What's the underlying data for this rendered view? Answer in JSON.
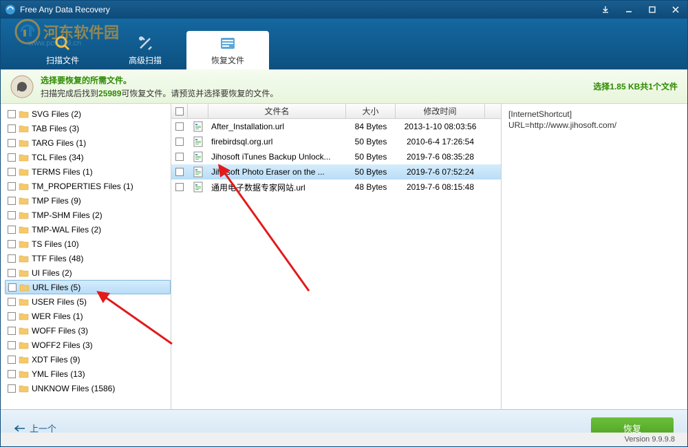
{
  "window": {
    "title": "Free Any Data Recovery"
  },
  "watermark": {
    "text": "河东软件园",
    "sub": "www.pc0359.cn"
  },
  "tabs": [
    {
      "label": "扫描文件",
      "active": false
    },
    {
      "label": "高级扫描",
      "active": false
    },
    {
      "label": "恢复文件",
      "active": true
    }
  ],
  "info": {
    "title": "选择要恢复的所需文件。",
    "sub_prefix": "扫描完成后找到",
    "count": "25989",
    "sub_suffix": "可恢复文件。请预览并选择要恢复的文件。",
    "right": "选择1.85 KB共1个文件"
  },
  "sidebar_items": [
    {
      "label": "SVG Files (2)"
    },
    {
      "label": "TAB Files (3)"
    },
    {
      "label": "TARG Files (1)"
    },
    {
      "label": "TCL Files (34)"
    },
    {
      "label": "TERMS Files (1)"
    },
    {
      "label": "TM_PROPERTIES Files (1)"
    },
    {
      "label": "TMP Files (9)"
    },
    {
      "label": "TMP-SHM Files (2)"
    },
    {
      "label": "TMP-WAL Files (2)"
    },
    {
      "label": "TS Files (10)"
    },
    {
      "label": "TTF Files (48)"
    },
    {
      "label": "UI Files (2)"
    },
    {
      "label": "URL Files (5)",
      "selected": true
    },
    {
      "label": "USER Files (5)"
    },
    {
      "label": "WER Files (1)"
    },
    {
      "label": "WOFF Files (3)"
    },
    {
      "label": "WOFF2 Files (3)"
    },
    {
      "label": "XDT Files (9)"
    },
    {
      "label": "YML Files (13)"
    },
    {
      "label": "UNKNOW Files (1586)"
    }
  ],
  "columns": {
    "name": "文件名",
    "size": "大小",
    "date": "修改时间"
  },
  "rows": [
    {
      "name": "After_Installation.url",
      "size": "84 Bytes",
      "date": "2013-1-10 08:03:56"
    },
    {
      "name": "firebirdsql.org.url",
      "size": "50 Bytes",
      "date": "2010-6-4 17:26:54"
    },
    {
      "name": "Jihosoft iTunes Backup Unlock...",
      "size": "50 Bytes",
      "date": "2019-7-6 08:35:28"
    },
    {
      "name": "Jihosoft Photo Eraser on the ...",
      "size": "50 Bytes",
      "date": "2019-7-6 07:52:24",
      "selected": true
    },
    {
      "name": "通用电子数据专家网站.url",
      "size": "48 Bytes",
      "date": "2019-7-6 08:15:48"
    }
  ],
  "preview": {
    "line1": "[InternetShortcut]",
    "line2": "URL=http://www.jihosoft.com/"
  },
  "footer": {
    "back": "上一个",
    "recover": "恢复"
  },
  "status": {
    "version": "Version 9.9.9.8"
  }
}
